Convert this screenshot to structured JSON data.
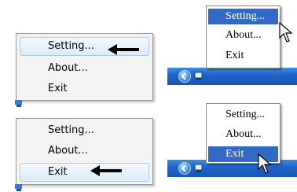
{
  "menus": {
    "top_left": {
      "items": [
        "Setting...",
        "About...",
        "Exit"
      ],
      "highlighted": "Setting..."
    },
    "bottom_left": {
      "items": [
        "Setting...",
        "About...",
        "Exit"
      ],
      "highlighted": "Exit"
    },
    "top_right": {
      "items": [
        "Setting...",
        "About...",
        "Exit"
      ],
      "highlighted": "Setting..."
    },
    "bottom_right": {
      "items": [
        "Setting...",
        "About...",
        "Exit"
      ],
      "highlighted": "Exit"
    }
  },
  "colors": {
    "xp_highlight": "#316ac5",
    "xp_taskbar": "#2a6fd6",
    "w7_highlight_border": "#a9cbe6"
  },
  "icons": [
    "arrow-left-icon",
    "mouse-cursor-icon",
    "tray-app-icon",
    "chevron-left-icon"
  ]
}
